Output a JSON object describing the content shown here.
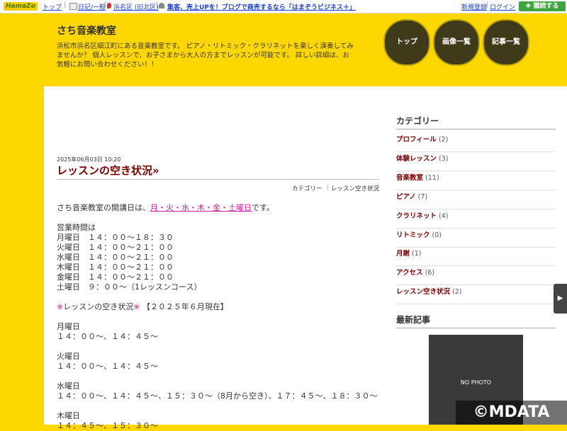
{
  "topbar": {
    "logo": "HamaZo",
    "top": "トップ",
    "diary": "日記/一般",
    "region": "浜名区 (旧北区)",
    "biz": "集客、売上UPを！ブログで商売するなら「はまぞうビジネス＋」",
    "register": "新規登録",
    "login": "ログイン",
    "subscribe": "購読する"
  },
  "header": {
    "title": "さち音楽教室",
    "description": "浜松市浜名区細江町にある音楽教室です。 ピアノ・リトミック・クラリネットを楽しく演奏してみませんか？ 個人レッスンで、お子さまから大人の方までレッスンが可能です。 詳しい詳細は、お気軽にお問い合わせください！！",
    "nav": [
      "トップ",
      "画像一覧",
      "記事一覧"
    ]
  },
  "post": {
    "date": "2025年06月03日 10:20",
    "title": "レッスンの空き状況»",
    "category_label": "カテゴリー",
    "category_value": "レッスン空き状況",
    "intro_prefix": "さち音楽教室の開講日は、",
    "intro_days": "月・火・水・木・金・土曜日",
    "intro_suffix": "です。",
    "hours_title": "営業時間は",
    "hours": [
      "月曜日　１４：００〜１８：３０",
      "火曜日　１４：００〜２１：００",
      "水曜日　１４：００〜２１：００",
      "木曜日　１４：００〜２１：００",
      "金曜日　１４：００〜２１：００",
      "土曜日　９：００〜（1レッスンコース）"
    ],
    "availability_title": "レッスンの空き状況",
    "availability_date": "【２０２５年６月現在】",
    "slots": [
      {
        "day": "月曜日",
        "times": "１４：００〜、１４：４５〜"
      },
      {
        "day": "火曜日",
        "times": "１４：００〜、１４：４５〜"
      },
      {
        "day": "水曜日",
        "times": "１４：００〜、１４：４５〜、１５：３０〜（8月から空き）、１７：４５〜、１８：３０〜"
      },
      {
        "day": "木曜日",
        "times": "１４：４５〜、１５：３０〜"
      }
    ]
  },
  "sidebar": {
    "categories_title": "カテゴリー",
    "categories": [
      {
        "name": "プロフィール",
        "count": "(2)"
      },
      {
        "name": "体験レッスン",
        "count": "(3)"
      },
      {
        "name": "音楽教室",
        "count": "(11)"
      },
      {
        "name": "ピアノ",
        "count": "(7)"
      },
      {
        "name": "クラリネット",
        "count": "(4)"
      },
      {
        "name": "リトミック",
        "count": "(0)"
      },
      {
        "name": "月謝",
        "count": "(1)"
      },
      {
        "name": "アクセス",
        "count": "(6)"
      },
      {
        "name": "レッスン空き状況",
        "count": "(2)"
      }
    ],
    "recent_title": "最新記事",
    "nophoto": "NO PHOTO"
  },
  "watermark": "©MDATA",
  "colors": {
    "background": "#ffd700",
    "title": "#7a0000",
    "link": "#1a3fcc",
    "highlight": "#d020a0"
  }
}
